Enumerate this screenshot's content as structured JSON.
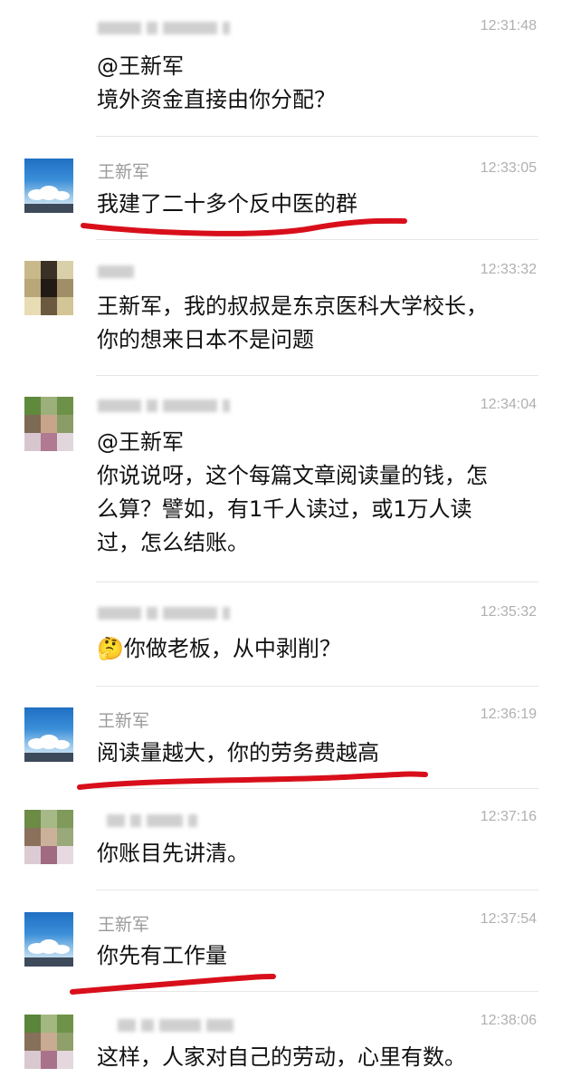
{
  "messages": [
    {
      "sender": "",
      "time": "12:31:48",
      "lines": [
        "@王新军",
        "境外资金直接由你分配？"
      ]
    },
    {
      "sender": "王新军",
      "time": "12:33:05",
      "lines": [
        "我建了二十多个反中医的群"
      ]
    },
    {
      "sender": "",
      "time": "12:33:32",
      "lines": [
        "王新军，我的叔叔是东京医科大学校长，",
        "你的想来日本不是问题"
      ]
    },
    {
      "sender": "",
      "time": "12:34:04",
      "lines": [
        "@王新军",
        "你说说呀，这个每篇文章阅读量的钱，怎",
        "么算？譬如，有1千人读过，或1万人读",
        "过，怎么结账。"
      ]
    },
    {
      "sender": "",
      "time": "12:35:32",
      "emoji": "🤔",
      "lines": [
        "你做老板，从中剥削？"
      ]
    },
    {
      "sender": "王新军",
      "time": "12:36:19",
      "lines": [
        "阅读量越大，你的劳务费越高"
      ]
    },
    {
      "sender": "",
      "time": "12:37:16",
      "lines": [
        "你账目先讲清。"
      ]
    },
    {
      "sender": "王新军",
      "time": "12:37:54",
      "lines": [
        "你先有工作量"
      ]
    },
    {
      "sender": "",
      "time": "12:38:06",
      "lines": [
        "这样，人家对自己的劳动，心里有数。"
      ]
    }
  ],
  "colors": {
    "underline": "#d80f1a",
    "name": "#9a9a9a",
    "time": "#b0b0b0",
    "text": "#111111",
    "divider": "#e6e6e6"
  }
}
